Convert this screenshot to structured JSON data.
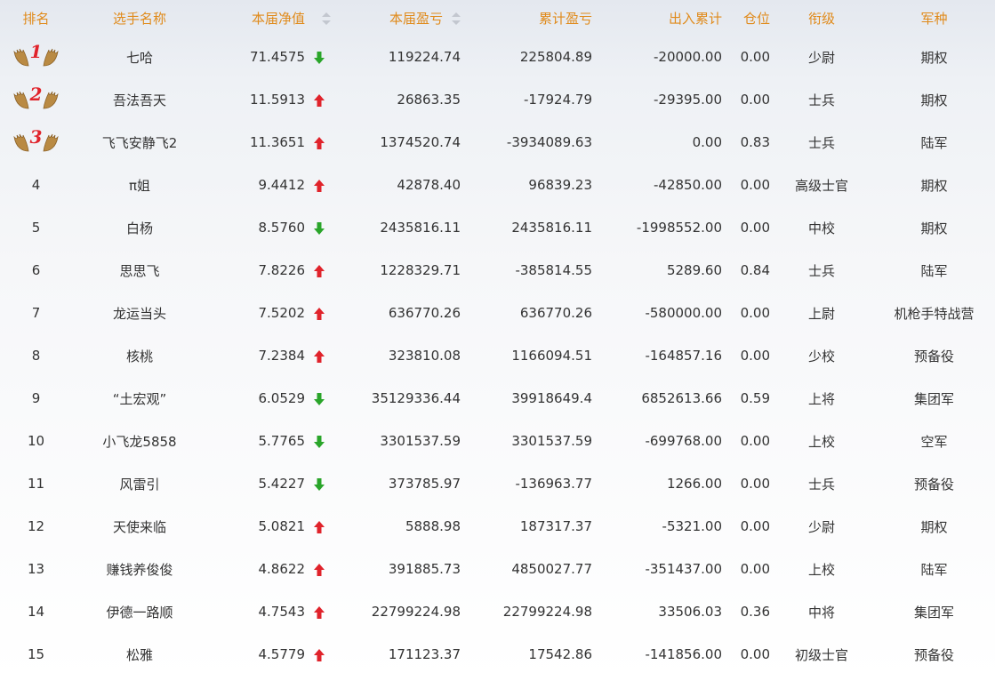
{
  "headers": {
    "rank": "排名",
    "name": "选手名称",
    "net": "本届净值",
    "profit": "本届盈亏",
    "cumulative": "累计盈亏",
    "inout": "出入累计",
    "position": "仓位",
    "rank_title": "衔级",
    "arm": "军种"
  },
  "colors": {
    "header_text": "#e08a1a",
    "up_arrow": "#e0232b",
    "down_arrow": "#2aa52a",
    "medal_number": "#e0232b"
  },
  "rows": [
    {
      "rank": "1",
      "name": "七哈",
      "net": "71.4575",
      "trend": "down",
      "profit": "119224.74",
      "cumulative": "225804.89",
      "inout": "-20000.00",
      "position": "0.00",
      "rank_title": "少尉",
      "arm": "期权"
    },
    {
      "rank": "2",
      "name": "吾法吾天",
      "net": "11.5913",
      "trend": "up",
      "profit": "26863.35",
      "cumulative": "-17924.79",
      "inout": "-29395.00",
      "position": "0.00",
      "rank_title": "士兵",
      "arm": "期权"
    },
    {
      "rank": "3",
      "name": "飞飞安静飞2",
      "net": "11.3651",
      "trend": "up",
      "profit": "1374520.74",
      "cumulative": "-3934089.63",
      "inout": "0.00",
      "position": "0.83",
      "rank_title": "士兵",
      "arm": "陆军"
    },
    {
      "rank": "4",
      "name": "π姐",
      "net": "9.4412",
      "trend": "up",
      "profit": "42878.40",
      "cumulative": "96839.23",
      "inout": "-42850.00",
      "position": "0.00",
      "rank_title": "高级士官",
      "arm": "期权"
    },
    {
      "rank": "5",
      "name": "白杨",
      "net": "8.5760",
      "trend": "down",
      "profit": "2435816.11",
      "cumulative": "2435816.11",
      "inout": "-1998552.00",
      "position": "0.00",
      "rank_title": "中校",
      "arm": "期权"
    },
    {
      "rank": "6",
      "name": "思思飞",
      "net": "7.8226",
      "trend": "up",
      "profit": "1228329.71",
      "cumulative": "-385814.55",
      "inout": "5289.60",
      "position": "0.84",
      "rank_title": "士兵",
      "arm": "陆军"
    },
    {
      "rank": "7",
      "name": "龙运当头",
      "net": "7.5202",
      "trend": "up",
      "profit": "636770.26",
      "cumulative": "636770.26",
      "inout": "-580000.00",
      "position": "0.00",
      "rank_title": "上尉",
      "arm": "机枪手特战营"
    },
    {
      "rank": "8",
      "name": "核桃",
      "net": "7.2384",
      "trend": "up",
      "profit": "323810.08",
      "cumulative": "1166094.51",
      "inout": "-164857.16",
      "position": "0.00",
      "rank_title": "少校",
      "arm": "预备役"
    },
    {
      "rank": "9",
      "name": "“土宏观”",
      "net": "6.0529",
      "trend": "down",
      "profit": "35129336.44",
      "cumulative": "39918649.4",
      "inout": "6852613.66",
      "position": "0.59",
      "rank_title": "上将",
      "arm": "集团军"
    },
    {
      "rank": "10",
      "name": "小飞龙5858",
      "net": "5.7765",
      "trend": "down",
      "profit": "3301537.59",
      "cumulative": "3301537.59",
      "inout": "-699768.00",
      "position": "0.00",
      "rank_title": "上校",
      "arm": "空军"
    },
    {
      "rank": "11",
      "name": "风雷引",
      "net": "5.4227",
      "trend": "down",
      "profit": "373785.97",
      "cumulative": "-136963.77",
      "inout": "1266.00",
      "position": "0.00",
      "rank_title": "士兵",
      "arm": "预备役"
    },
    {
      "rank": "12",
      "name": "天使来临",
      "net": "5.0821",
      "trend": "up",
      "profit": "5888.98",
      "cumulative": "187317.37",
      "inout": "-5321.00",
      "position": "0.00",
      "rank_title": "少尉",
      "arm": "期权"
    },
    {
      "rank": "13",
      "name": "赚钱养俊俊",
      "net": "4.8622",
      "trend": "up",
      "profit": "391885.73",
      "cumulative": "4850027.77",
      "inout": "-351437.00",
      "position": "0.00",
      "rank_title": "上校",
      "arm": "陆军"
    },
    {
      "rank": "14",
      "name": "伊德一路顺",
      "net": "4.7543",
      "trend": "up",
      "profit": "22799224.98",
      "cumulative": "22799224.98",
      "inout": "33506.03",
      "position": "0.36",
      "rank_title": "中将",
      "arm": "集团军"
    },
    {
      "rank": "15",
      "name": "松雅",
      "net": "4.5779",
      "trend": "up",
      "profit": "171123.37",
      "cumulative": "17542.86",
      "inout": "-141856.00",
      "position": "0.00",
      "rank_title": "初级士官",
      "arm": "预备役"
    }
  ]
}
